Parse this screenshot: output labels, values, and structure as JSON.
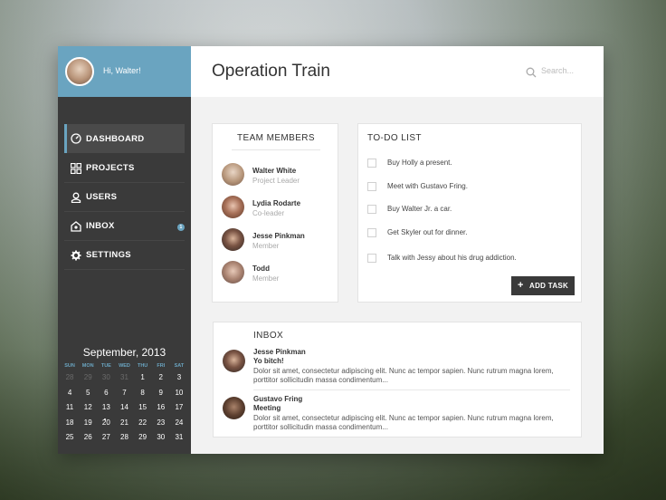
{
  "user": {
    "greeting": "Hi, Walter!"
  },
  "nav": [
    {
      "label": "DASHBOARD",
      "icon": "dashboard-icon",
      "active": true
    },
    {
      "label": "PROJECTS",
      "icon": "grid-icon"
    },
    {
      "label": "USERS",
      "icon": "user-icon"
    },
    {
      "label": "INBOX",
      "icon": "inbox-icon",
      "badge": "1"
    },
    {
      "label": "SETTINGS",
      "icon": "gear-icon"
    }
  ],
  "calendar": {
    "title": "September, 2013",
    "weekdays": [
      "SUN",
      "MON",
      "TUE",
      "WED",
      "THU",
      "FRI",
      "SAT"
    ],
    "days": [
      [
        "28",
        "29",
        "30",
        "31",
        "1",
        "2",
        "3"
      ],
      [
        "4",
        "5",
        "6",
        "7",
        "8",
        "9",
        "10"
      ],
      [
        "11",
        "12",
        "13",
        "14",
        "15",
        "16",
        "17"
      ],
      [
        "18",
        "19",
        "20",
        "21",
        "22",
        "23",
        "24"
      ],
      [
        "25",
        "26",
        "27",
        "28",
        "29",
        "30",
        "31"
      ]
    ]
  },
  "header": {
    "title": "Operation Train",
    "search_placeholder": "Search..."
  },
  "team": {
    "title": "TEAM MEMBERS",
    "members": [
      {
        "name": "Walter White",
        "role": "Project Leader"
      },
      {
        "name": "Lydia Rodarte",
        "role": "Co-leader"
      },
      {
        "name": "Jesse Pinkman",
        "role": "Member"
      },
      {
        "name": "Todd",
        "role": "Member"
      }
    ]
  },
  "todo": {
    "title": "TO-DO LIST",
    "tasks": [
      "Buy Holly a present.",
      "Meet with Gustavo Fring.",
      "Buy Walter Jr. a car.",
      "Get Skyler out for dinner.",
      "Talk with Jessy about his drug addiction."
    ],
    "add_label": "ADD TASK"
  },
  "inbox": {
    "title": "INBOX",
    "messages": [
      {
        "from": "Jesse Pinkman",
        "subject": "Yo bitch!",
        "body": "Dolor sit amet, consectetur adipiscing elit. Nunc ac tempor sapien. Nunc rutrum magna lorem, porttitor sollicitudin massa condimentum..."
      },
      {
        "from": "Gustavo Fring",
        "subject": "Meeting",
        "body": "Dolor sit amet, consectetur adipiscing elit. Nunc ac tempor sapien. Nunc rutrum magna lorem, porttitor sollicitudin massa condimentum..."
      }
    ]
  }
}
